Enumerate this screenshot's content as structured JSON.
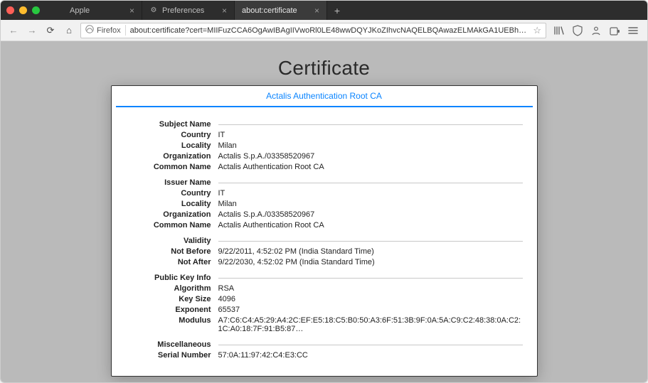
{
  "window": {
    "tabs": [
      {
        "label": "Apple",
        "favicon": ""
      },
      {
        "label": "Preferences",
        "favicon": "⚙"
      },
      {
        "label": "about:certificate",
        "favicon": ""
      }
    ],
    "active_tab_index": 2
  },
  "toolbar": {
    "identity_label": "Firefox",
    "url": "about:certificate?cert=MIIFuzCCA6OgAwIBAgIIVwoRl0LE48wwDQYJKoZIhvcNAQELBQAwazELMAkGA1UEBhMCSVQx…"
  },
  "page": {
    "heading": "Certificate",
    "cert_tab_label": "Actalis Authentication Root CA",
    "sections": [
      {
        "title": "Subject Name",
        "rows": [
          {
            "k": "Country",
            "v": "IT"
          },
          {
            "k": "Locality",
            "v": "Milan"
          },
          {
            "k": "Organization",
            "v": "Actalis S.p.A./03358520967"
          },
          {
            "k": "Common Name",
            "v": "Actalis Authentication Root CA"
          }
        ]
      },
      {
        "title": "Issuer Name",
        "rows": [
          {
            "k": "Country",
            "v": "IT"
          },
          {
            "k": "Locality",
            "v": "Milan"
          },
          {
            "k": "Organization",
            "v": "Actalis S.p.A./03358520967"
          },
          {
            "k": "Common Name",
            "v": "Actalis Authentication Root CA"
          }
        ]
      },
      {
        "title": "Validity",
        "rows": [
          {
            "k": "Not Before",
            "v": "9/22/2011, 4:52:02 PM (India Standard Time)"
          },
          {
            "k": "Not After",
            "v": "9/22/2030, 4:52:02 PM (India Standard Time)"
          }
        ]
      },
      {
        "title": "Public Key Info",
        "rows": [
          {
            "k": "Algorithm",
            "v": "RSA"
          },
          {
            "k": "Key Size",
            "v": "4096"
          },
          {
            "k": "Exponent",
            "v": "65537"
          },
          {
            "k": "Modulus",
            "v": "A7:C6:C4:A5:29:A4:2C:EF:E5:18:C5:B0:50:A3:6F:51:3B:9F:0A:5A:C9:C2:48:38:0A:C2:1C:A0:18:7F:91:B5:87…"
          }
        ]
      },
      {
        "title": "Miscellaneous",
        "rows": [
          {
            "k": "Serial Number",
            "v": "57:0A:11:97:42:C4:E3:CC"
          }
        ]
      }
    ]
  }
}
